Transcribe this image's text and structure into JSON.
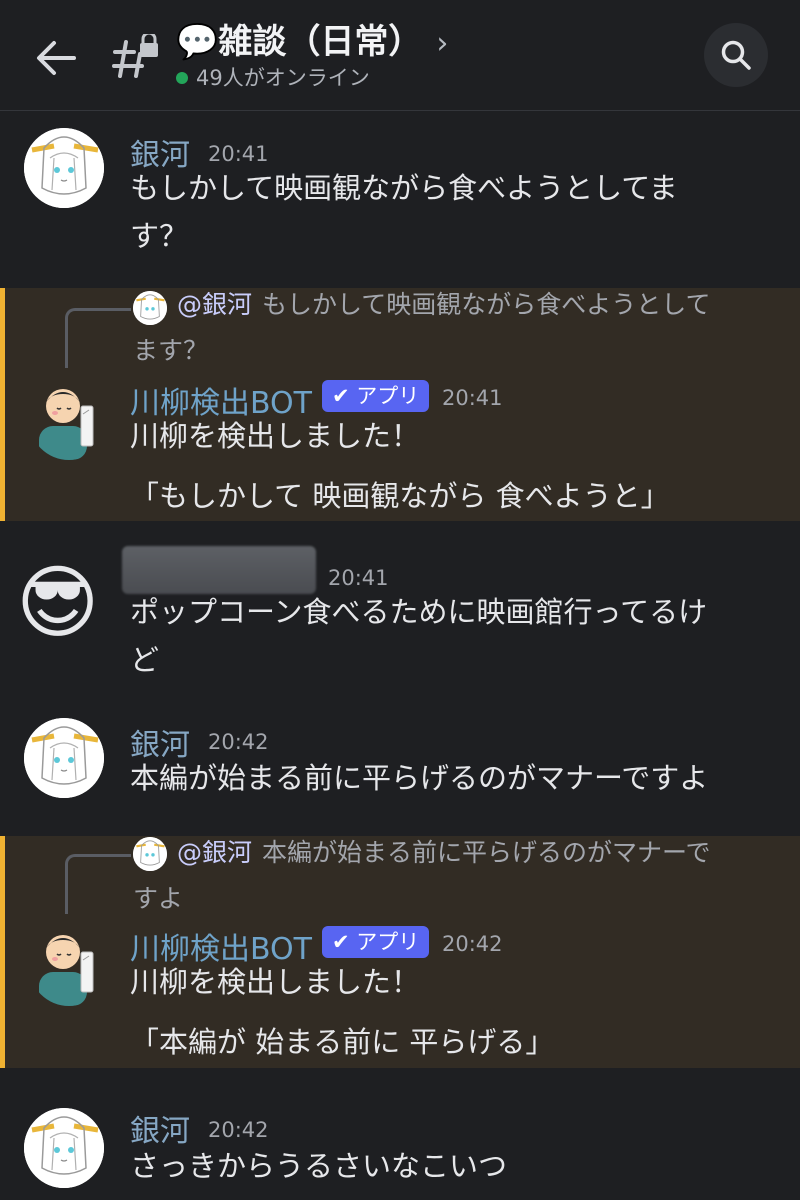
{
  "header": {
    "channel_emoji": "💬",
    "channel_name": "雑談（日常）",
    "chevron": "›",
    "online_text": "49人がオンライン",
    "icons": {
      "back": "arrow-left-icon",
      "channel": "locked-hashtag-icon",
      "search": "search-icon"
    }
  },
  "messages": [
    {
      "author": "銀河",
      "time": "20:41",
      "lines": [
        "もしかして映画観ながら食べようとしてま",
        "す？"
      ]
    },
    {
      "reply": {
        "mention": "@銀河",
        "line1": "もしかして映画観ながら食べようとして",
        "line2": "ます？"
      },
      "author": "川柳検出BOT",
      "badge": "✔ アプリ",
      "time": "20:41",
      "line1": "川柳を検出しました！",
      "line2": "「もしかして 映画観ながら 食べようと」"
    },
    {
      "author": "",
      "time": "20:41",
      "lines": [
        "ポップコーン食べるために映画館行ってるけ",
        "ど"
      ],
      "avatar_emoji": "😎"
    },
    {
      "author": "銀河",
      "time": "20:42",
      "lines": [
        "本編が始まる前に平らげるのがマナーですよ"
      ]
    },
    {
      "reply": {
        "mention": "@銀河",
        "line1": "本編が始まる前に平らげるのがマナーで",
        "line2": "すよ"
      },
      "author": "川柳検出BOT",
      "badge": "✔ アプリ",
      "time": "20:42",
      "line1": "川柳を検出しました！",
      "line2": "「本編が 始まる前に 平らげる」"
    },
    {
      "author": "銀河",
      "time": "20:42",
      "lines": [
        "さっきからうるさいなこいつ"
      ]
    }
  ],
  "colors": {
    "ginga_name": "#86a7c4",
    "bot_name": "#6fa3c9",
    "highlight_bar": "#f0b232",
    "badge": "#5865f2",
    "online_dot": "#23a55a"
  }
}
